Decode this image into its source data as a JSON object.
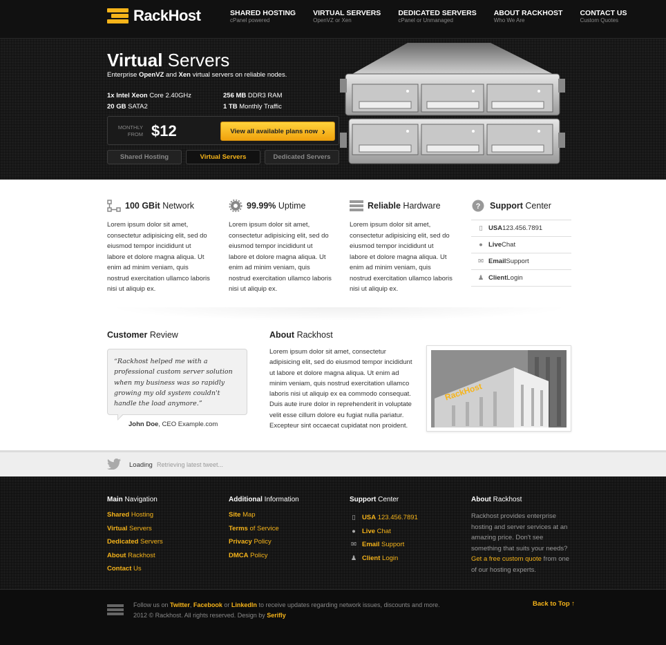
{
  "brand": {
    "name": "RackHost",
    "accent": "#f6b41a"
  },
  "nav": [
    {
      "title": "SHARED HOSTING",
      "sub": "cPanel powered"
    },
    {
      "title": "VIRTUAL SERVERS",
      "sub": "OpenVZ or Xen"
    },
    {
      "title": "DEDICATED SERVERS",
      "sub": "cPanel or Unmanaged"
    },
    {
      "title": "ABOUT RACKHOST",
      "sub": "Who We Are"
    },
    {
      "title": "CONTACT US",
      "sub": "Custom Quotes"
    }
  ],
  "hero": {
    "title_bold": "Virtual",
    "title_rest": " Servers",
    "sub_pre": "Enterprise ",
    "sub_b1": "OpenVZ",
    "sub_mid": " and ",
    "sub_b2": "Xen",
    "sub_post": " virtual servers on reliable nodes.",
    "specs": [
      {
        "b": "1x Intel Xeon",
        "r": " Core 2.40GHz"
      },
      {
        "b": "256 MB",
        "r": " DDR3 RAM"
      },
      {
        "b": "20 GB",
        "r": " SATA2"
      },
      {
        "b": "1 TB",
        "r": " Monthly Traffic"
      }
    ],
    "price_label_1": "MONTHLY",
    "price_label_2": "FROM",
    "price": "$12",
    "cta_pre": "View all ",
    "cta_rest": "available plans now",
    "cta_arrow": "›",
    "tabs": [
      "Shared Hosting",
      "Virtual Servers",
      "Dedicated Servers"
    ],
    "active_tab": 1
  },
  "features": [
    {
      "icon": "network-icon",
      "bold": "100 GBit",
      "rest": " Network",
      "text": "Lorem ipsum dolor sit amet, consectetur adipisicing elit, sed do eiusmod tempor incididunt ut labore et dolore magna aliqua. Ut enim ad minim veniam, quis nostrud exercitation ullamco laboris nisi ut aliquip ex."
    },
    {
      "icon": "gear-icon",
      "bold": "99.99%",
      "rest": " Uptime",
      "text": "Lorem ipsum dolor sit amet, consectetur adipisicing elit, sed do eiusmod tempor incididunt ut labore et dolore magna aliqua. Ut enim ad minim veniam, quis nostrud exercitation ullamco laboris nisi ut aliquip ex."
    },
    {
      "icon": "hardware-icon",
      "bold": "Reliable",
      "rest": " Hardware",
      "text": "Lorem ipsum dolor sit amet, consectetur adipisicing elit, sed do eiusmod tempor incididunt ut labore et dolore magna aliqua. Ut enim ad minim veniam, quis nostrud exercitation ullamco laboris nisi ut aliquip ex."
    }
  ],
  "support": {
    "bold": "Support",
    "rest": " Center",
    "items": [
      {
        "icon": "phone-icon",
        "bold": "USA",
        "rest": " 123.456.7891"
      },
      {
        "icon": "chat-icon",
        "bold": "Live",
        "rest": " Chat"
      },
      {
        "icon": "mail-icon",
        "bold": "Email",
        "rest": " Support"
      },
      {
        "icon": "user-icon",
        "bold": "Client",
        "rest": " Login"
      }
    ]
  },
  "review": {
    "h_bold": "Customer",
    "h_rest": " Review",
    "quote": "“Rackhost helped me with a professional custom server solution when my business was so rapidly growing my old system couldn't handle the load anymore.”",
    "author_bold": "John Doe",
    "author_rest": ", CEO Example.com"
  },
  "about": {
    "h_bold": "About",
    "h_rest": " Rackhost",
    "text": "Lorem ipsum dolor sit amet, consectetur adipisicing elit, sed do eiusmod tempor incididunt ut labore et dolore magna aliqua. Ut enim ad minim veniam, quis nostrud exercitation ullamco laboris nisi ut aliquip ex ea commodo consequat. Duis aute irure dolor in reprehenderit in voluptate velit esse cillum dolore eu fugiat nulla pariatur. Excepteur sint occaecat cupidatat non proident.",
    "photo_sign": "RackHost"
  },
  "twitter": {
    "label": "Loading",
    "message": "Retrieving latest tweet..."
  },
  "footer": {
    "col1": {
      "h_bold": "Main",
      "h_rest": " Navigation",
      "links": [
        {
          "b": "Shared",
          "r": " Hosting"
        },
        {
          "b": "Virtual",
          "r": " Servers"
        },
        {
          "b": "Dedicated",
          "r": " Servers"
        },
        {
          "b": "About",
          "r": " Rackhost"
        },
        {
          "b": "Contact",
          "r": " Us"
        }
      ]
    },
    "col2": {
      "h_bold": "Additional",
      "h_rest": " Information",
      "links": [
        {
          "b": "Site",
          "r": " Map"
        },
        {
          "b": "Terms",
          "r": " of Service"
        },
        {
          "b": "Privacy",
          "r": " Policy"
        },
        {
          "b": "DMCA",
          "r": " Policy"
        }
      ]
    },
    "col3": {
      "h_bold": "Support",
      "h_rest": " Center",
      "links": [
        {
          "icon": "phone-icon",
          "b": "USA",
          "r": " 123.456.7891"
        },
        {
          "icon": "chat-icon",
          "b": "Live",
          "r": " Chat"
        },
        {
          "icon": "mail-icon",
          "b": "Email",
          "r": " Support"
        },
        {
          "icon": "user-icon",
          "b": "Client",
          "r": " Login"
        }
      ]
    },
    "col4": {
      "h_bold": "About",
      "h_rest": " Rackhost",
      "text": "Rackhost provides enterprise hosting and server services at an amazing price. Don't see something that suits your needs?",
      "link": "Get a free custom quote",
      "text2": " from one of our hosting experts."
    }
  },
  "bottom": {
    "follow_pre": "Follow us on ",
    "twitter": "Twitter",
    "comma": ", ",
    "facebook": "Facebook",
    "or": " or ",
    "linkedin": "LinkedIn",
    "follow_post": " to receive updates regarding network issues, discounts and more.",
    "copyright": "2012 © Rackhost. All rights reserved. Design by ",
    "designer": "Serifly",
    "back_to_top": "Back to Top ↑"
  }
}
